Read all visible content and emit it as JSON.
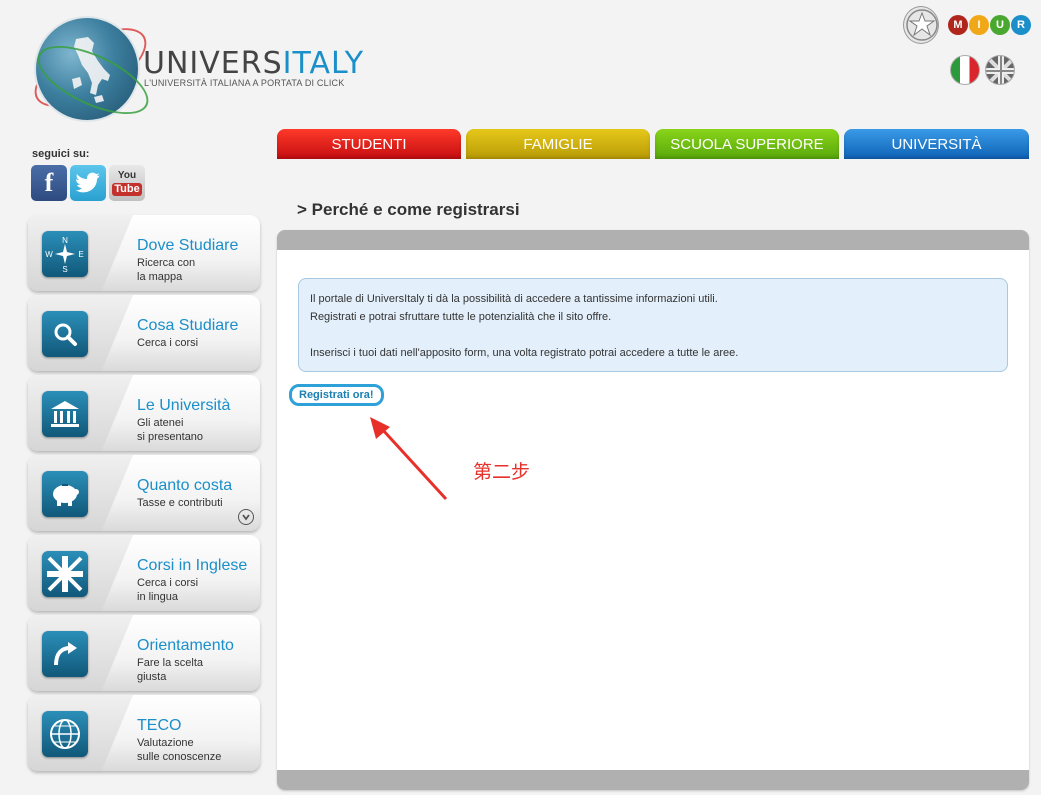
{
  "header": {
    "brand_prefix": "UNIVERS",
    "brand_suffix": "ITALY",
    "tagline": "L'UNIVERSITÀ ITALIANA A PORTATA DI CLICK",
    "miur_letters": [
      "M",
      "I",
      "U",
      "R"
    ],
    "miur_colors": [
      "#b0261c",
      "#f0a818",
      "#4aa830",
      "#1a8fc9"
    ]
  },
  "social": {
    "label": "seguici su:",
    "facebook": "f",
    "youtube_you": "You",
    "youtube_tube": "Tube"
  },
  "sidebar": {
    "items": [
      {
        "title": "Dove Studiare",
        "subtitle": "Ricerca con\nla mappa",
        "icon": "compass-icon"
      },
      {
        "title": "Cosa Studiare",
        "subtitle": "Cerca i corsi",
        "icon": "magnifier-icon"
      },
      {
        "title": "Le Università",
        "subtitle": "Gli atenei\nsi presentano",
        "icon": "university-building-icon"
      },
      {
        "title": "Quanto costa",
        "subtitle": "Tasse e contributi",
        "icon": "piggy-bank-icon"
      },
      {
        "title": "Corsi in Inglese",
        "subtitle": "Cerca i corsi\nin lingua",
        "icon": "uk-flag-icon"
      },
      {
        "title": "Orientamento",
        "subtitle": "Fare la scelta\ngiusta",
        "icon": "curved-arrow-icon"
      },
      {
        "title": "TECO",
        "subtitle": "Valutazione\nsulle conoscenze",
        "icon": "globe-network-icon"
      }
    ]
  },
  "tabs": [
    {
      "label": "STUDENTI",
      "color": "#e8201a"
    },
    {
      "label": "FAMIGLIE",
      "color": "#d4b410"
    },
    {
      "label": "SCUOLA SUPERIORE",
      "color": "#72c010"
    },
    {
      "label": "UNIVERSITÀ",
      "color": "#2080d0"
    }
  ],
  "main": {
    "title": "> Perché e come registrarsi",
    "info_line1": "Il portale di UniversItaly ti dà la possibilità di accedere a tantissime informazioni utili.",
    "info_line2": "Registrati e potrai sfruttare tutte le potenzialità che il sito offre.",
    "info_line3": "Inserisci i tuoi dati nell'apposito form, una volta registrato potrai accedere a tutte le aree.",
    "register_button": "Registrati ora!"
  },
  "annotation": {
    "text": "第二步",
    "color": "#e8302a"
  }
}
